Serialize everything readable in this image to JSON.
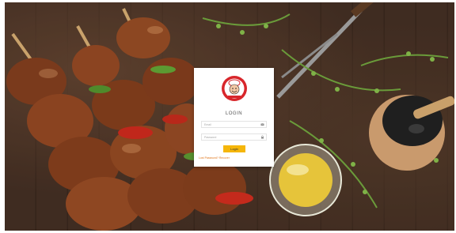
{
  "login": {
    "title": "LOGIN",
    "email_placeholder": "Email",
    "password_placeholder": "Password",
    "button_label": "Login",
    "forgot_link": "Lost Password? Recover"
  },
  "icons": {
    "email_field_icon": "envelope-icon",
    "password_field_icon": "lock-icon",
    "brand_logo": "chef-mascot-logo"
  },
  "colors": {
    "accent_button": "#f5b60a",
    "link": "#e0761a",
    "logo_red": "#d8262b"
  }
}
